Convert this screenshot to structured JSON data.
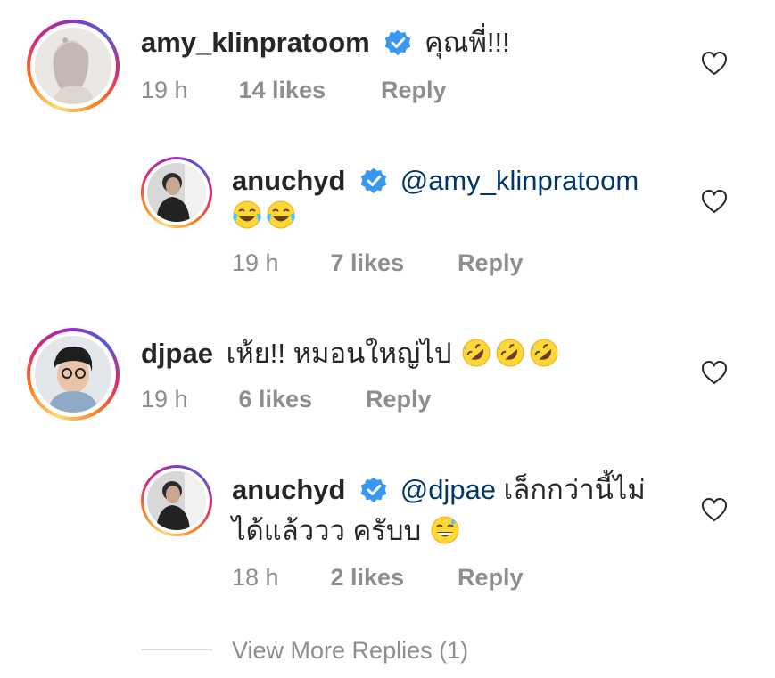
{
  "comments": [
    {
      "username": "amy_klinpratoom",
      "text": "คุณพี่!!!",
      "time": "19 h",
      "likes": "14 likes",
      "reply": "Reply"
    },
    {
      "username": "anuchyd",
      "mention": "@amy_klinpratoom",
      "time": "19 h",
      "likes": "7 likes",
      "reply": "Reply",
      "emojis": [
        "face-with-tears-of-joy",
        "face-with-tears-of-joy"
      ]
    },
    {
      "username": "djpae",
      "text": "เห้ย!! หมอนใหญ่ไป",
      "time": "19 h",
      "likes": "6 likes",
      "reply": "Reply",
      "emojis": [
        "rolling-on-floor-laughing",
        "rolling-on-floor-laughing",
        "rolling-on-floor-laughing"
      ]
    },
    {
      "username": "anuchyd",
      "mention": "@djpae",
      "text_line1": "เล็กกว่านี้ไม่",
      "text_line2": "ได้แล้ววว ครับบ",
      "time": "18 h",
      "likes": "2 likes",
      "reply": "Reply",
      "emojis": [
        "grinning-face-with-sweat"
      ]
    }
  ],
  "view_more": "View More Replies (1)",
  "colors": {
    "verified": "#3897f0",
    "mention": "#00376b",
    "meta": "#8e8e8e",
    "emoji": "#fdd835"
  }
}
